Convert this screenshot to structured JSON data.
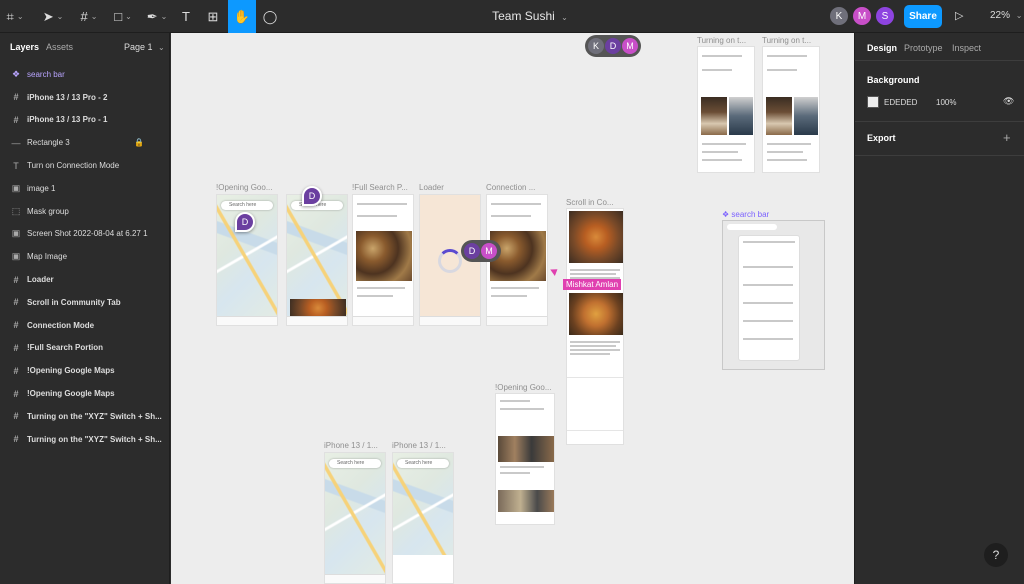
{
  "toolbar": {
    "tools": [
      {
        "name": "main-menu-icon",
        "glyph": "⌗"
      },
      {
        "name": "move-tool-icon",
        "glyph": "➤"
      },
      {
        "name": "frame-tool-icon",
        "glyph": "#"
      },
      {
        "name": "shape-tool-icon",
        "glyph": "□"
      },
      {
        "name": "pen-tool-icon",
        "glyph": "✒"
      },
      {
        "name": "text-tool-icon",
        "glyph": "T"
      },
      {
        "name": "resources-icon",
        "glyph": "⊞"
      },
      {
        "name": "hand-tool-icon",
        "glyph": "✋"
      },
      {
        "name": "comment-tool-icon",
        "glyph": "◯"
      }
    ],
    "title": "Team Sushi",
    "title_caret": "⌄",
    "collaborators": [
      {
        "initial": "K",
        "color": "#6f6f7a"
      },
      {
        "initial": "M",
        "color": "#c84fc8"
      },
      {
        "initial": "S",
        "color": "#8e44e0"
      }
    ],
    "share_label": "Share",
    "play_glyph": "▷",
    "zoom_label": "22%",
    "zoom_caret": "⌄"
  },
  "left_panel": {
    "tabs": [
      "Layers",
      "Assets"
    ],
    "page_label": "Page 1",
    "page_caret": "⌄",
    "layers": [
      {
        "label": "search bar",
        "icon": "❖",
        "kind": "component"
      },
      {
        "label": "iPhone 13 / 13 Pro - 2",
        "icon": "#",
        "kind": "frame"
      },
      {
        "label": "iPhone 13 / 13 Pro - 1",
        "icon": "#",
        "kind": "frame"
      },
      {
        "label": "Rectangle 3",
        "icon": "—",
        "kind": "rect",
        "locked": true
      },
      {
        "label": "Turn on Connection Mode",
        "icon": "T",
        "kind": "text"
      },
      {
        "label": "image 1",
        "icon": "▣",
        "kind": "image"
      },
      {
        "label": "Mask group",
        "icon": "⬚",
        "kind": "group"
      },
      {
        "label": "Screen Shot 2022-08-04 at 6.27 1",
        "icon": "▣",
        "kind": "image"
      },
      {
        "label": "Map Image",
        "icon": "▣",
        "kind": "image"
      },
      {
        "label": "Loader",
        "icon": "#",
        "kind": "frame"
      },
      {
        "label": "Scroll in Community Tab",
        "icon": "#",
        "kind": "frame"
      },
      {
        "label": "Connection Mode",
        "icon": "#",
        "kind": "frame"
      },
      {
        "label": "!Full Search Portion",
        "icon": "#",
        "kind": "frame"
      },
      {
        "label": "!Opening Google Maps",
        "icon": "#",
        "kind": "frame"
      },
      {
        "label": "!Opening Google Maps",
        "icon": "#",
        "kind": "frame"
      },
      {
        "label": "Turning on the \"XYZ\" Switch + Sh...",
        "icon": "#",
        "kind": "frame"
      },
      {
        "label": "Turning on the \"XYZ\" Switch + Sh...",
        "icon": "#",
        "kind": "frame"
      }
    ],
    "lock_glyph": "🔒"
  },
  "canvas": {
    "frame_labels": {
      "opening_google_1": "!Opening Goo...",
      "full_search": "!Full Search P...",
      "loader": "Loader",
      "connection": "Connection ...",
      "scroll_community": "Scroll in Co...",
      "turning_1": "Turning on t...",
      "turning_2": "Turning on t...",
      "search_bar": "❖ search bar",
      "opening_google_2": "!Opening Goo...",
      "iphone_1": "iPhone 13 / 1...",
      "iphone_2": "iPhone 13 / 1..."
    },
    "cursor_label": "Mishkat Amlan",
    "multi_cursor_initials": [
      "K",
      "D",
      "M"
    ],
    "cursor_d": "D",
    "phone_search_text": "Search here"
  },
  "right_panel": {
    "tabs": [
      "Design",
      "Prototype",
      "Inspect"
    ],
    "background_label": "Background",
    "background_hex": "EDEDED",
    "background_opacity": "100%",
    "eye_glyph": "👁",
    "export_label": "Export",
    "export_add": "+"
  },
  "help_glyph": "?"
}
